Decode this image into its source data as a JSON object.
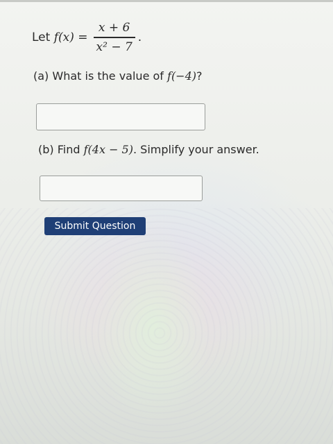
{
  "problem": {
    "let_label": "Let",
    "function_name": "f(x)",
    "equals": "=",
    "numerator": "x + 6",
    "denominator": "x² − 7",
    "period": "."
  },
  "part_a": {
    "label": "(a) What is the value of",
    "expression": "f(−4)",
    "end": "?",
    "answer_value": ""
  },
  "part_b": {
    "label": "(b) Find",
    "expression": "f(4x − 5)",
    "end": ". Simplify your answer.",
    "answer_value": ""
  },
  "submit": {
    "label": "Submit Question",
    "color": "#1f3f76"
  }
}
